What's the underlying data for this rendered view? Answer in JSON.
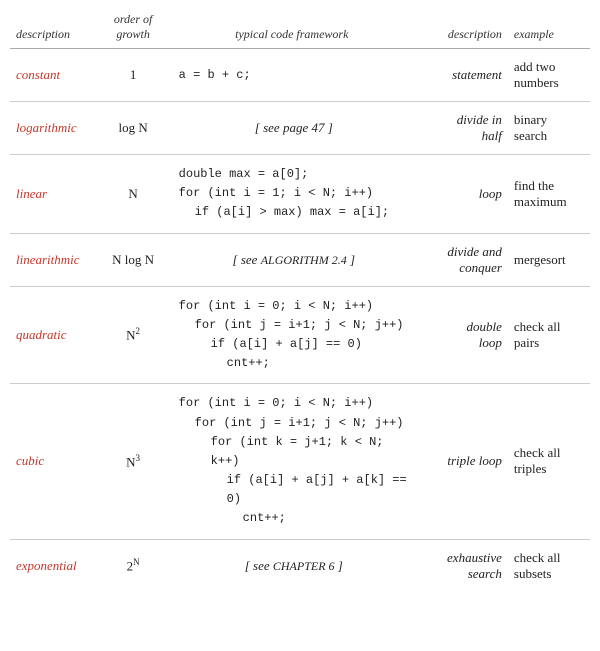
{
  "header": {
    "col1": "description",
    "col2": "order of\ngrowth",
    "col3": "typical code framework",
    "col4": "description",
    "col5": "example"
  },
  "rows": [
    {
      "id": "constant",
      "desc": "constant",
      "growth": "1",
      "growth_html": "1",
      "code_type": "plain",
      "code": "a = b + c;",
      "desc2": "statement",
      "example": "add two\nnumbers"
    },
    {
      "id": "logarithmic",
      "desc": "logarithmic",
      "growth_html": "log N",
      "code_type": "see",
      "code": "[ see page 47 ]",
      "desc2": "divide in\nhalf",
      "example": "binary\nsearch"
    },
    {
      "id": "linear",
      "desc": "linear",
      "growth_html": "N",
      "code_type": "block",
      "code_lines": [
        {
          "text": "double max = a[0];",
          "indent": 0
        },
        {
          "text": "for (int i = 1; i < N; i++)",
          "indent": 0
        },
        {
          "text": "if (a[i] > max) max = a[i];",
          "indent": 1
        }
      ],
      "desc2": "loop",
      "example": "find the\nmaximum"
    },
    {
      "id": "linearithmic",
      "desc": "linearithmic",
      "growth_html": "N log N",
      "code_type": "see-algo",
      "code": "[ see ALGORITHM 2.4 ]",
      "desc2": "divide and\nconquer",
      "example": "mergesort"
    },
    {
      "id": "quadratic",
      "desc": "quadratic",
      "growth_html": "N<sup>2</sup>",
      "code_type": "block",
      "code_lines": [
        {
          "text": "for (int i = 0; i < N; i++)",
          "indent": 0
        },
        {
          "text": "for (int j = i+1; j < N; j++)",
          "indent": 1
        },
        {
          "text": "if (a[i] + a[j] == 0)",
          "indent": 2
        },
        {
          "text": "cnt++;",
          "indent": 3
        }
      ],
      "desc2": "double\nloop",
      "example": "check all\npairs"
    },
    {
      "id": "cubic",
      "desc": "cubic",
      "growth_html": "N<sup>3</sup>",
      "code_type": "block",
      "code_lines": [
        {
          "text": "for (int i = 0; i < N; i++)",
          "indent": 0
        },
        {
          "text": "for (int j = i+1; j < N; j++)",
          "indent": 1
        },
        {
          "text": "for (int k = j+1; k < N; k++)",
          "indent": 2
        },
        {
          "text": "if (a[i] + a[j] + a[k] == 0)",
          "indent": 3
        },
        {
          "text": "cnt++;",
          "indent": 4
        }
      ],
      "desc2": "triple loop",
      "example": "check all\ntriples"
    },
    {
      "id": "exponential",
      "desc": "exponential",
      "growth_html": "2<sup>N</sup>",
      "code_type": "see-chapter",
      "code": "[ see CHAPTER 6 ]",
      "desc2": "exhaustive\nsearch",
      "example": "check all\nsubsets"
    }
  ]
}
